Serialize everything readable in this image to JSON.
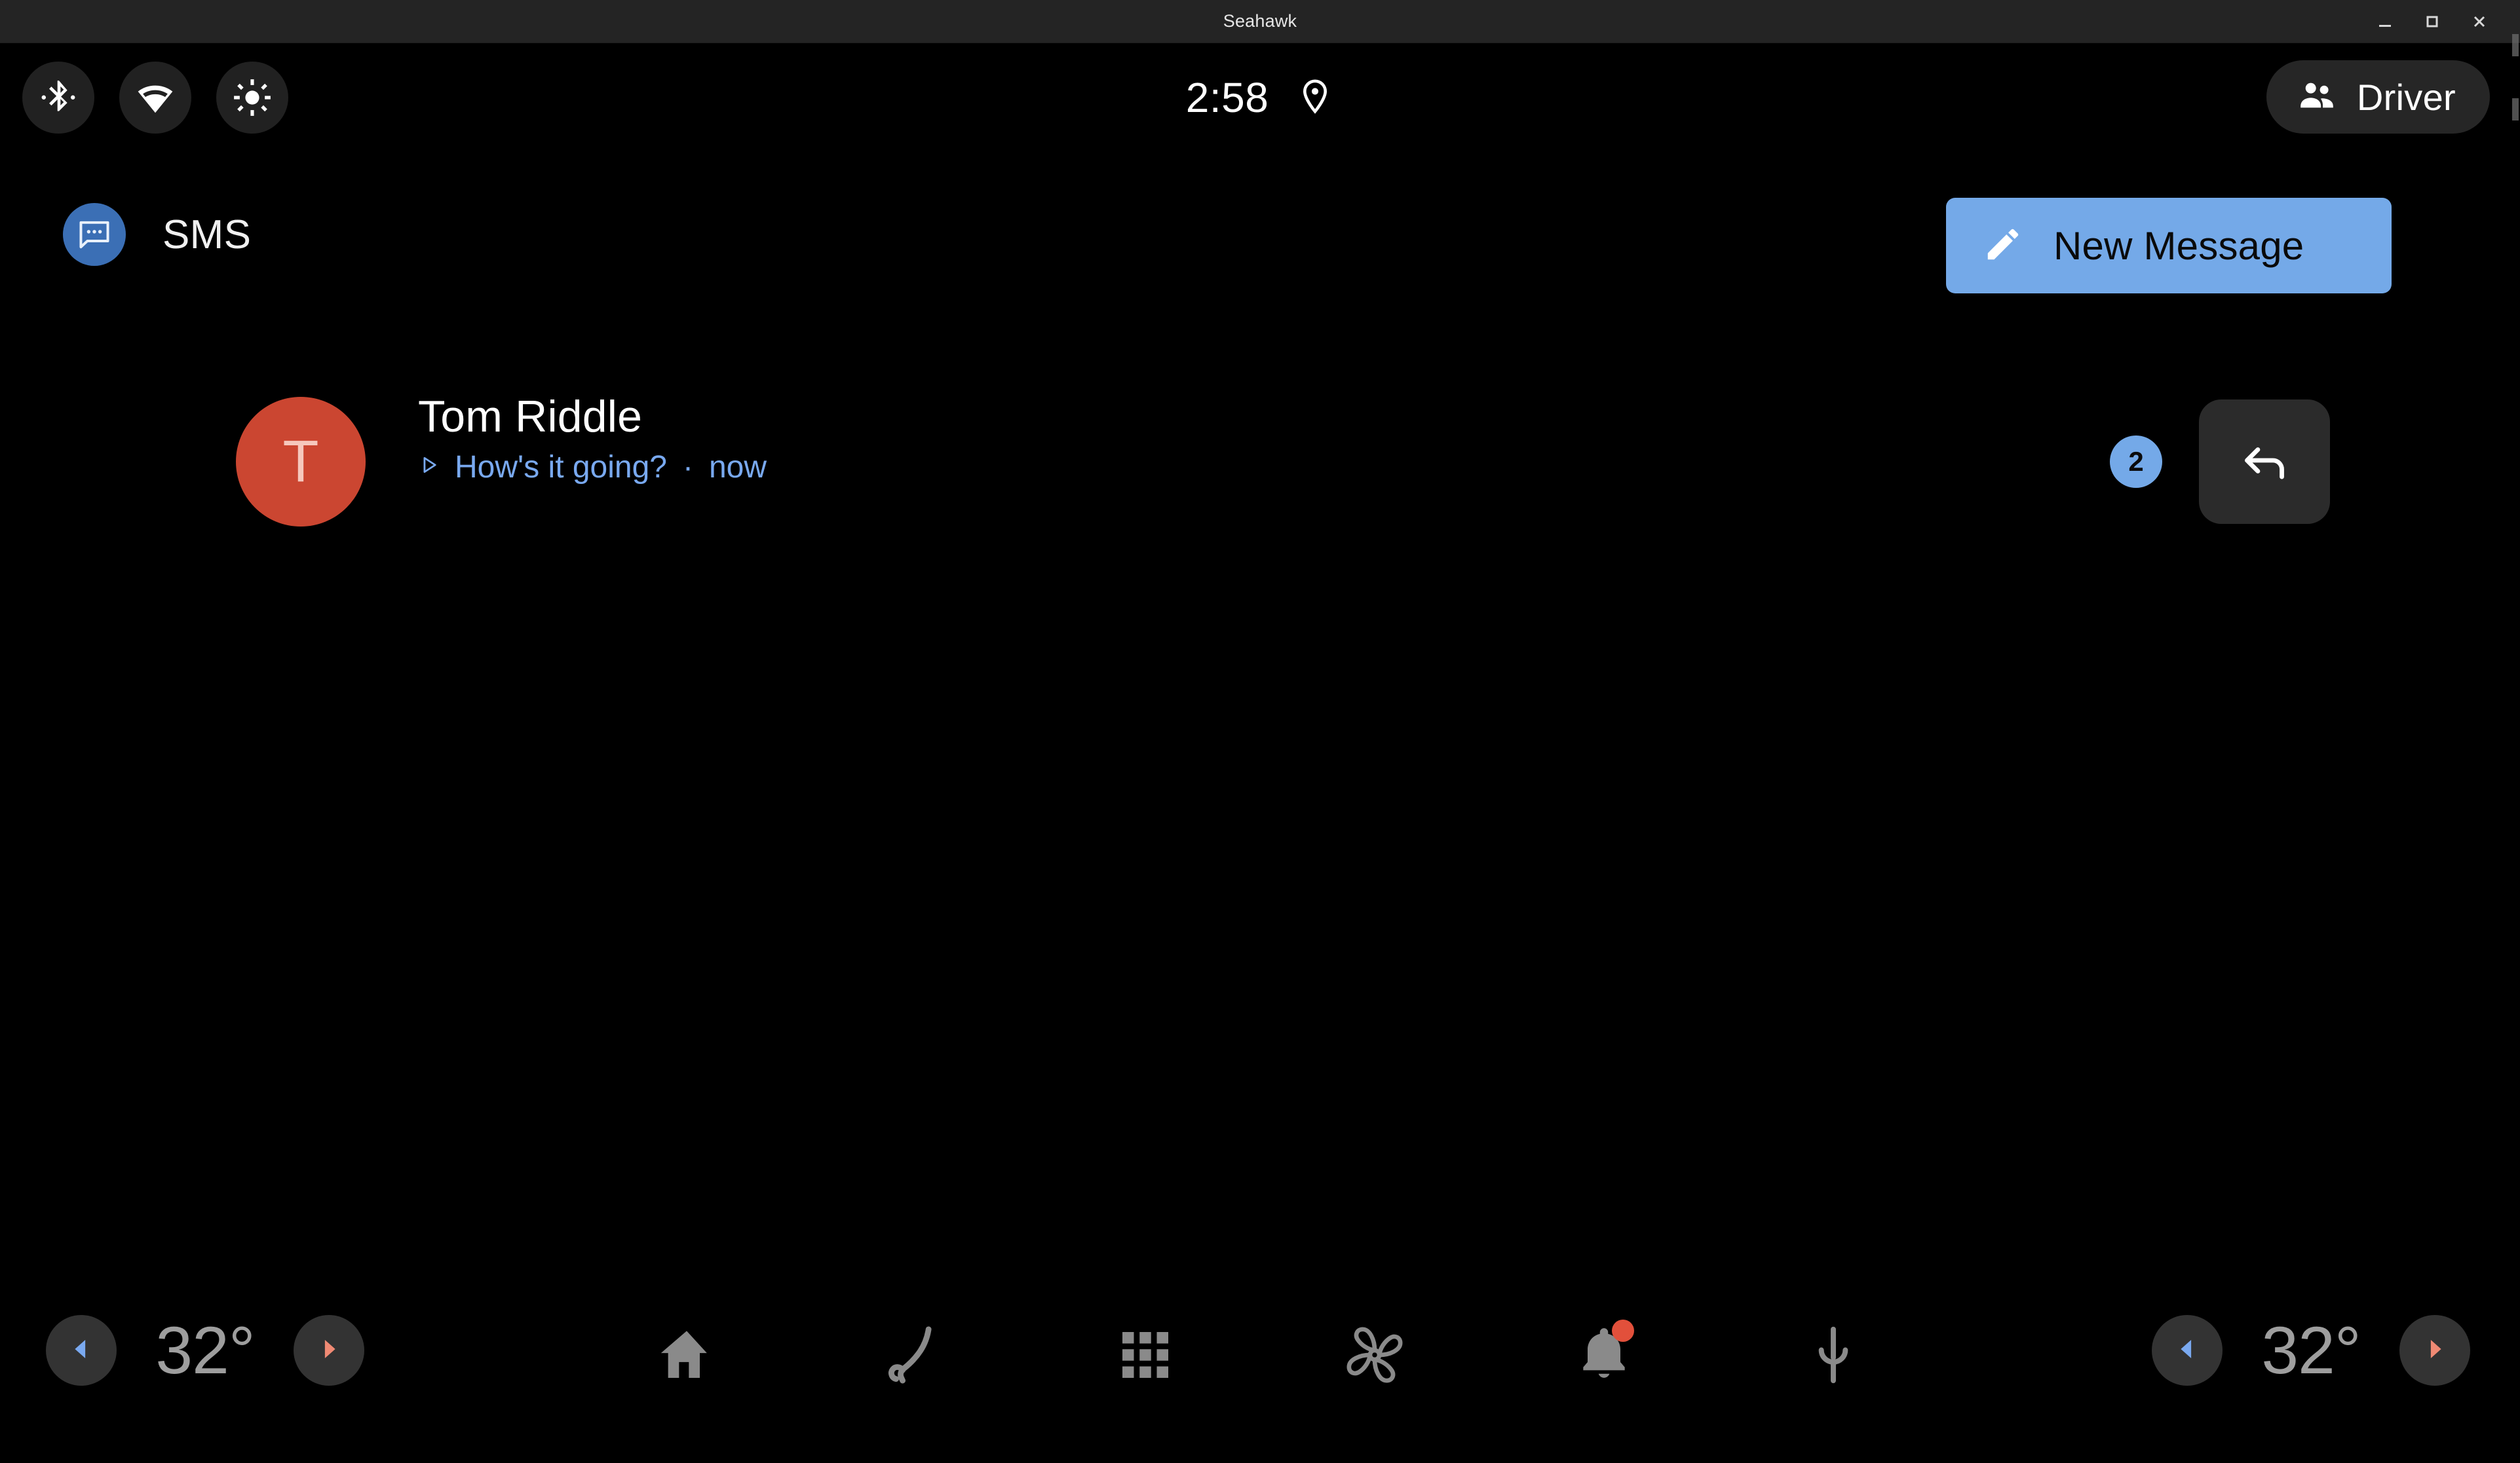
{
  "window": {
    "title": "Seahawk",
    "controls": [
      {
        "name": "minimize",
        "icon": "minimize-icon"
      },
      {
        "name": "maximize",
        "icon": "maximize-icon"
      },
      {
        "name": "close",
        "icon": "close-icon"
      }
    ]
  },
  "statusbar": {
    "quick_toggles": [
      {
        "icon": "bluetooth-icon",
        "label": "Bluetooth"
      },
      {
        "icon": "wifi-icon",
        "label": "Wi-Fi"
      },
      {
        "icon": "brightness-icon",
        "label": "Brightness"
      }
    ],
    "clock": "2:58",
    "location_icon": "location-pin-icon",
    "profile": {
      "label": "Driver",
      "icon": "people-icon"
    }
  },
  "app": {
    "icon": "sms-chat-bubble-icon",
    "title": "SMS",
    "new_message": {
      "label": "New Message",
      "icon": "pencil-icon",
      "color": "#74a9e8"
    }
  },
  "conversations": [
    {
      "avatar_letter": "T",
      "avatar_color": "#cb4631",
      "name": "Tom Riddle",
      "preview_icon": "play-triangle-icon",
      "preview": "How's it going?",
      "separator": "·",
      "timestamp": "now",
      "unread_count": "2",
      "reply_icon": "reply-arrow-icon"
    }
  ],
  "navbar": {
    "temp_left": {
      "value": "32°",
      "decrease_icon": "chevron-left-icon",
      "increase_icon": "chevron-right-icon",
      "decrease_color": "#7aa9f0",
      "increase_color": "#f08a74"
    },
    "temp_right": {
      "value": "32°",
      "decrease_icon": "chevron-left-icon",
      "increase_icon": "chevron-right-icon",
      "decrease_color": "#7aa9f0",
      "increase_color": "#f08a74"
    },
    "items": [
      {
        "icon": "home-icon",
        "label": "Home",
        "badge": false
      },
      {
        "icon": "phone-icon",
        "label": "Phone",
        "badge": false
      },
      {
        "icon": "apps-grid-icon",
        "label": "Apps",
        "badge": false
      },
      {
        "icon": "climate-fan-icon",
        "label": "Climate",
        "badge": false
      },
      {
        "icon": "bell-icon",
        "label": "Notifications",
        "badge": true
      },
      {
        "icon": "microphone-icon",
        "label": "Assistant",
        "badge": false
      }
    ],
    "badge_color": "#e2503b"
  },
  "colors": {
    "background": "#000000",
    "titlebar": "#242424",
    "chip": "#212121",
    "accent_blue": "#74a9e8",
    "preview_blue": "#79a9f0",
    "nav_icon": "#8a8a8a"
  }
}
